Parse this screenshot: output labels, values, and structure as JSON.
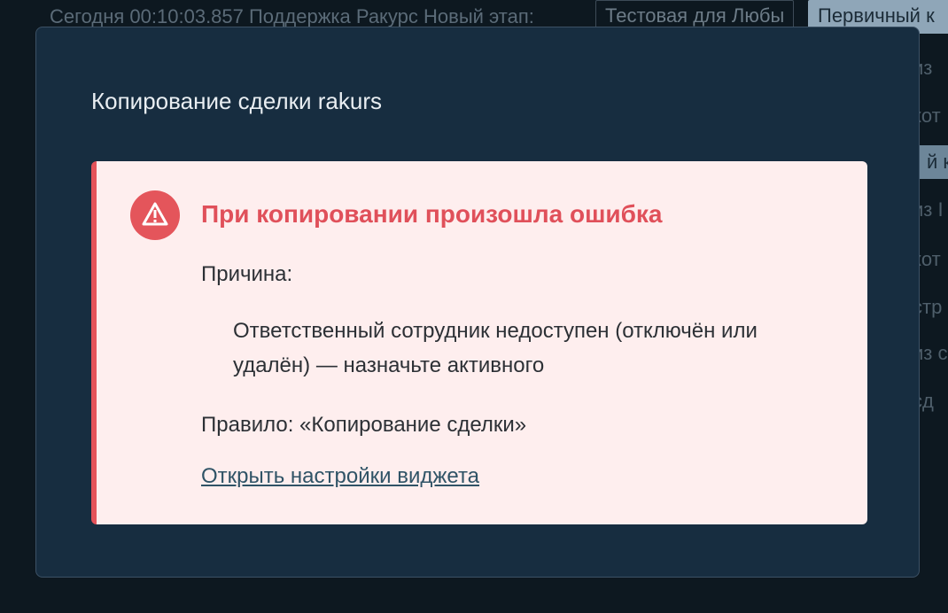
{
  "background": {
    "breadcrumb": "Сегодня 00:10:03.857 Поддержка Ракурс Новый этап:",
    "stage_chip": "Тестовая для Любы",
    "stage_chip_active": "Первичный к",
    "rows": [
      "из",
      "кот",
      "й к",
      "из I",
      "кот",
      "стр",
      "из с",
      "сд"
    ]
  },
  "modal": {
    "title": "Копирование сделки rakurs",
    "alert": {
      "icon": "warning-icon",
      "title": "При копировании произошла ошибка",
      "reason_label": "Причина:",
      "reason_text": "Ответственный сотрудник недоступен (отключён или удалён) — назначьте активного",
      "rule_text": "Правило: «Копирование сделки»",
      "link_text": "Открыть настройки виджета"
    }
  },
  "colors": {
    "modal_bg": "#172d40",
    "alert_bg": "#feeeee",
    "error_red": "#e4535a",
    "link": "#2f5366"
  }
}
